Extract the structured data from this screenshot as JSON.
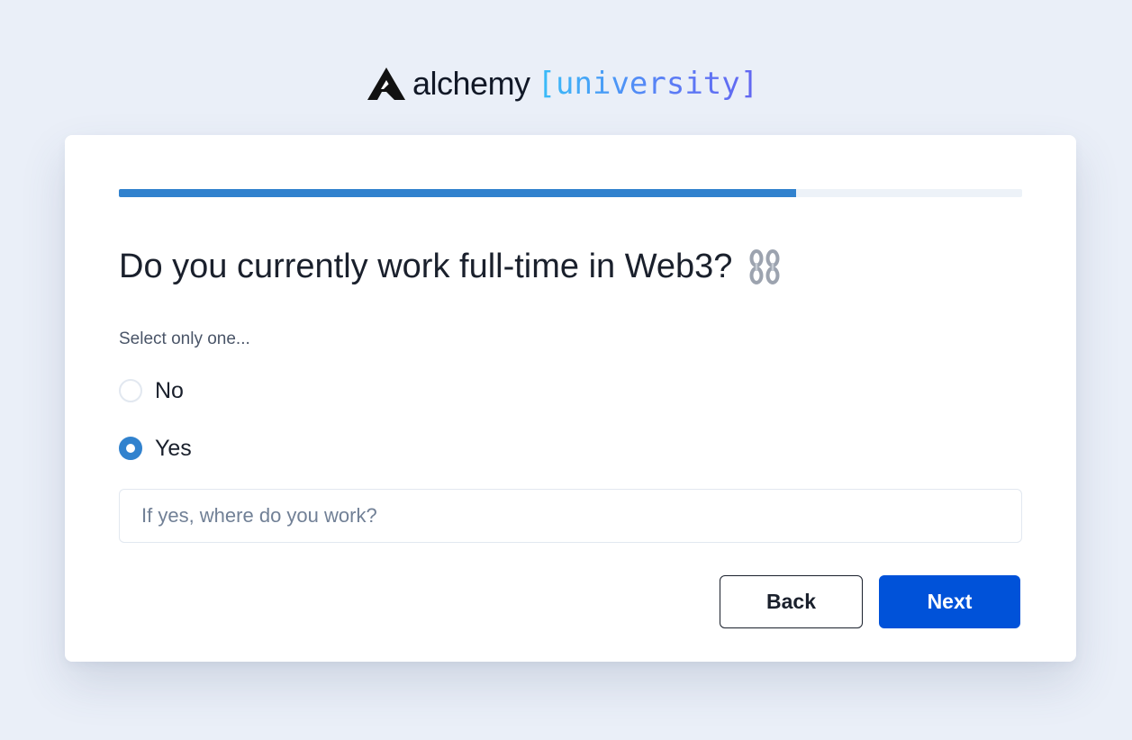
{
  "brand": {
    "wordmark": "alchemy",
    "tagline": "[university]",
    "logo_icon": "alchemy-triangle-icon"
  },
  "progress": {
    "fraction": 0.75,
    "color": "#3182ce"
  },
  "question": {
    "title": "Do you currently work full-time in Web3?",
    "emoji_icon": "chain-link-icon"
  },
  "options": {
    "hint": "Select only one...",
    "items": [
      {
        "label": "No",
        "selected": false
      },
      {
        "label": "Yes",
        "selected": true
      }
    ]
  },
  "workplace_input": {
    "placeholder": "If yes, where do you work?",
    "value": ""
  },
  "actions": {
    "back_label": "Back",
    "next_label": "Next",
    "primary_color": "#0052d9"
  }
}
